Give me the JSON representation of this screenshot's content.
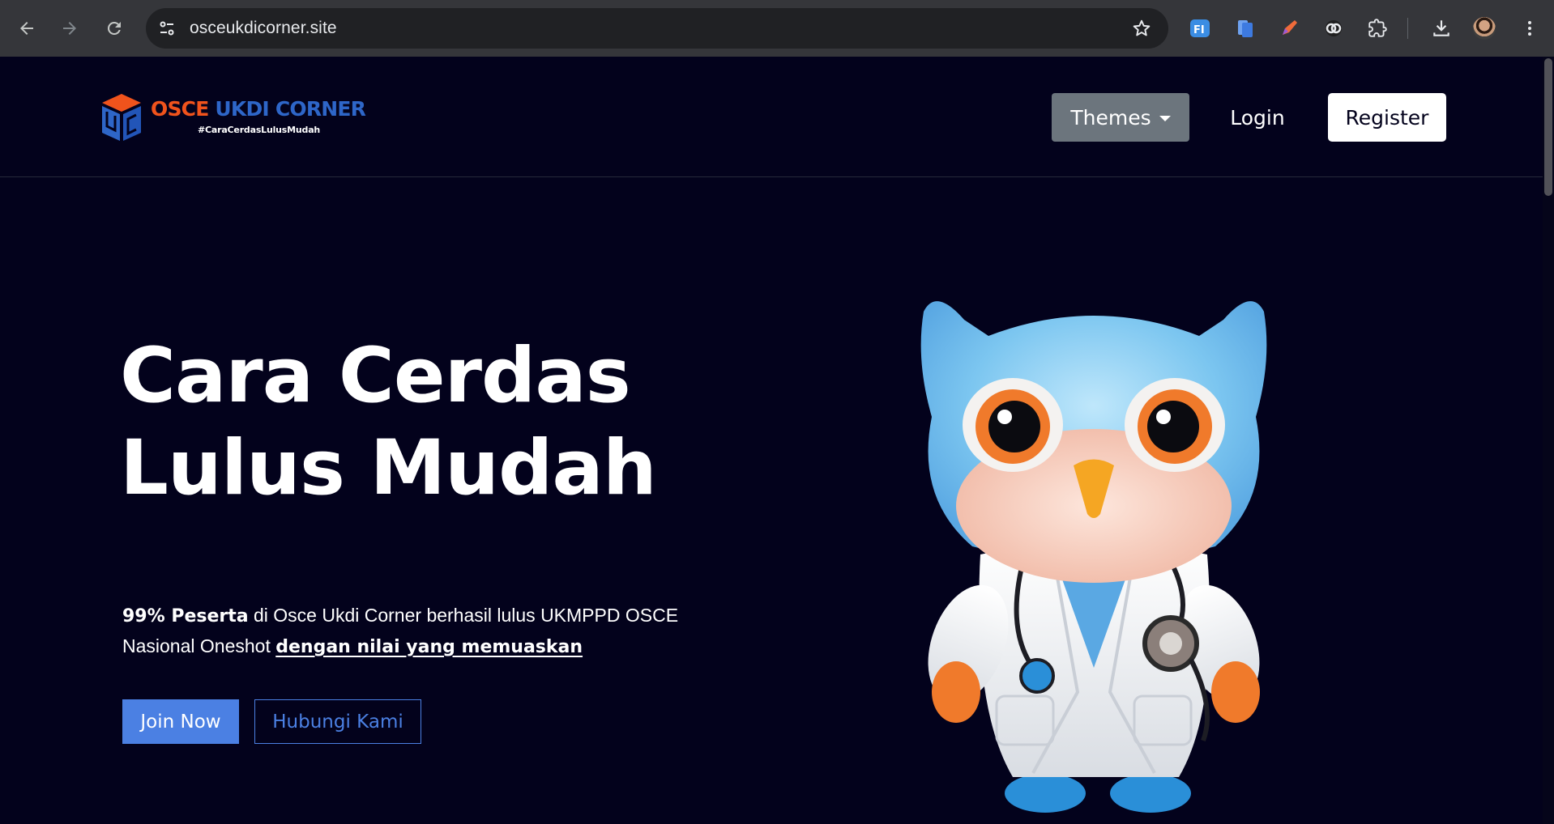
{
  "browser": {
    "url": "osceukdicorner.site",
    "nav_icons": [
      "back-arrow-icon",
      "forward-arrow-icon",
      "reload-icon"
    ],
    "omnibox_icons": [
      "site-settings-icon",
      "bookmark-star-icon"
    ],
    "extension_icons": [
      "translate-extension-icon",
      "docs-extension-icon",
      "pen-extension-icon",
      "link-extension-icon",
      "puzzle-extensions-icon",
      "download-icon",
      "profile-avatar",
      "more-menu-icon"
    ]
  },
  "header": {
    "logo": {
      "word1": "OSCE",
      "word2": "UKDI CORNER",
      "tagline": "#CaraCerdasLulusMudah",
      "colors": {
        "orange": "#f0531c",
        "blue": "#2e66c8"
      }
    },
    "themes_label": "Themes",
    "login_label": "Login",
    "register_label": "Register"
  },
  "hero": {
    "title_line1": "Cara Cerdas",
    "title_line2": "Lulus Mudah",
    "desc_strong": "99% Peserta",
    "desc_text": " di Osce Ukdi Corner berhasil lulus UKMPPD OSCE Nasional Oneshot ",
    "desc_link": "dengan nilai yang memuaskan",
    "join_label": "Join Now",
    "contact_label": "Hubungi Kami",
    "illustration": "owl-doctor-mascot"
  },
  "colors": {
    "page_bg": "#03021c",
    "accent": "#4b80e3",
    "themes_btn": "#6c757d"
  }
}
